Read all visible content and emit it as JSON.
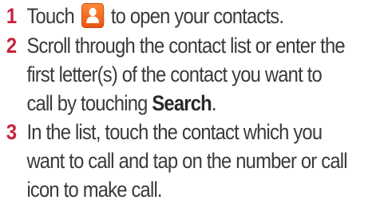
{
  "steps": [
    {
      "number": "1",
      "before_icon": "Touch",
      "icon": "contacts-icon",
      "after_icon": "to open your contacts."
    },
    {
      "number": "2",
      "line1": "Scroll through the contact list or enter the",
      "line2": "first letter(s) of the contact you want to",
      "line3_before": "call by touching",
      "line3_bold": "Search",
      "line3_after": "."
    },
    {
      "number": "3",
      "line1": "In the list, touch the contact which you",
      "line2": "want to call and tap on the number or call",
      "line3": "icon to make call."
    }
  ],
  "colors": {
    "step_number": "#c8203c",
    "text": "#3a3a3a",
    "icon_orange": "#f06a20"
  }
}
